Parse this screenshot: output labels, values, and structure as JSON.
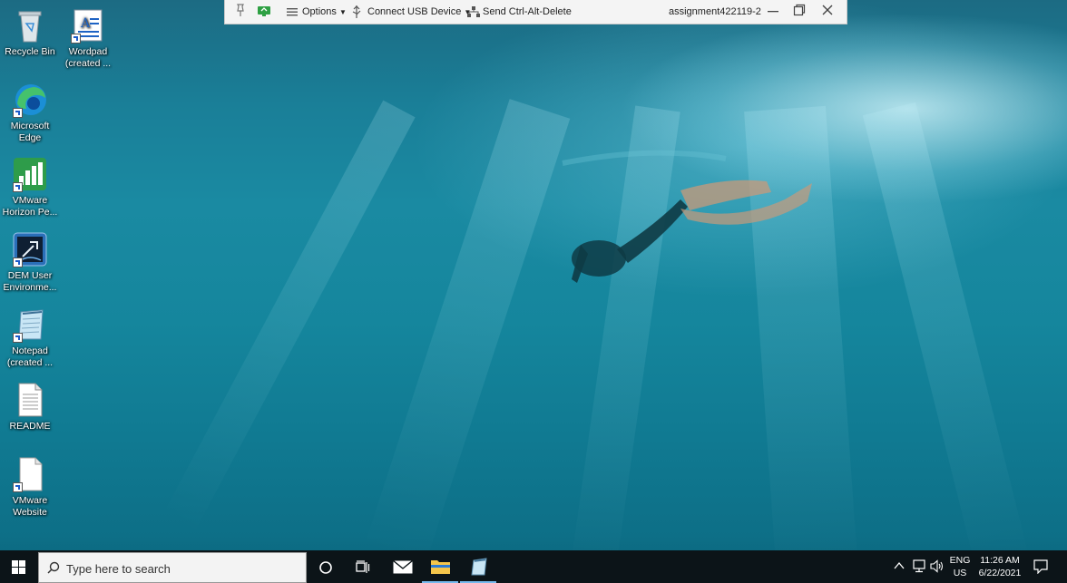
{
  "session_bar": {
    "options_label": "Options",
    "usb_label": "Connect USB Device",
    "send_cad_label": "Send Ctrl-Alt-Delete",
    "machine_name": "assignment422119-2"
  },
  "desktop_icons": [
    {
      "label": "Recycle Bin",
      "icon": "recycle-bin-icon"
    },
    {
      "label": "Wordpad (created ...",
      "icon": "wordpad-icon"
    },
    {
      "label": "Microsoft Edge",
      "icon": "edge-icon"
    },
    {
      "label": "VMware Horizon Pe...",
      "icon": "vmware-horizon-icon"
    },
    {
      "label": "DEM User Environme...",
      "icon": "dem-icon"
    },
    {
      "label": "Notepad (created ...",
      "icon": "notepad-icon"
    },
    {
      "label": "README",
      "icon": "text-file-icon"
    },
    {
      "label": "VMware Website",
      "icon": "blank-file-icon"
    }
  ],
  "taskbar": {
    "search_placeholder": "Type here to search",
    "language_line1": "ENG",
    "language_line2": "US",
    "time": "11:26 AM",
    "date": "6/22/2021"
  },
  "colors": {
    "taskbar": "#0c1418",
    "accent": "#0078d7",
    "session_bar": "#f4f4f4"
  }
}
